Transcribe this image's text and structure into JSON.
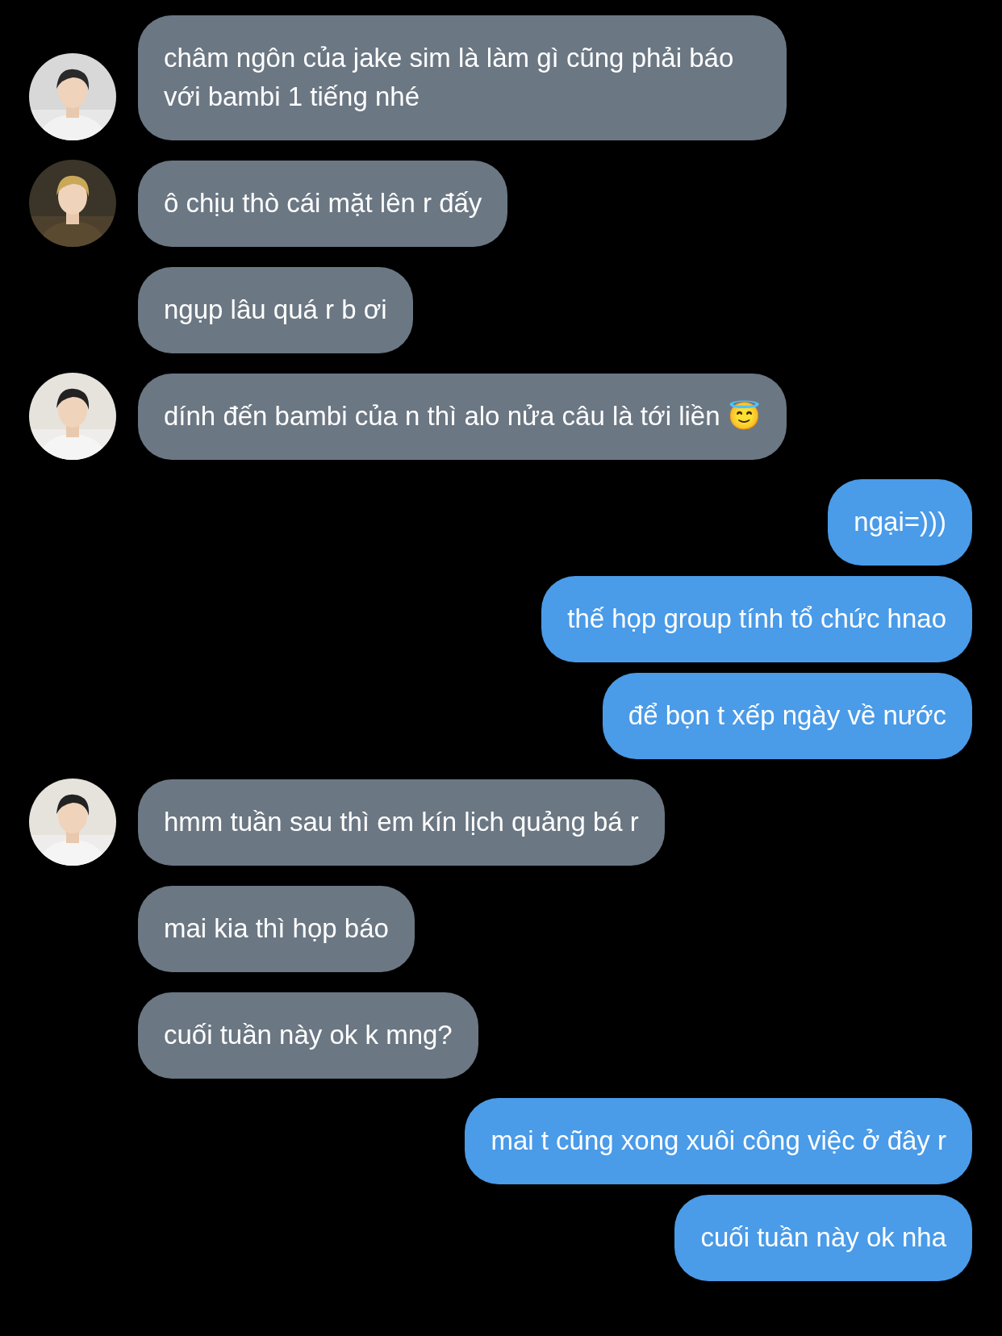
{
  "messages": [
    {
      "kind": "incoming",
      "text": "châm ngôn của jake sim là làm gì cũng phải báo với bambi 1 tiếng nhé"
    },
    {
      "kind": "incoming",
      "text": "ô chịu thò cái mặt lên r đấy"
    },
    {
      "kind": "incoming",
      "text": "ngụp lâu quá r b ơi"
    },
    {
      "kind": "incoming",
      "text": "dính đến bambi của n thì alo nửa câu là tới liền 😇"
    },
    {
      "kind": "outgoing",
      "text": "ngại=)))"
    },
    {
      "kind": "outgoing",
      "text": "thế họp group tính tổ chức hnao"
    },
    {
      "kind": "outgoing",
      "text": "để bọn t xếp ngày về nước"
    },
    {
      "kind": "incoming",
      "text": "hmm tuần sau thì em kín lịch quảng bá r"
    },
    {
      "kind": "incoming",
      "text": "mai kia thì họp báo"
    },
    {
      "kind": "incoming",
      "text": "cuối tuần này ok k mng?"
    },
    {
      "kind": "outgoing",
      "text": "mai t cũng xong xuôi công việc ở đây r"
    },
    {
      "kind": "outgoing",
      "text": "cuối tuần này ok nha"
    }
  ]
}
